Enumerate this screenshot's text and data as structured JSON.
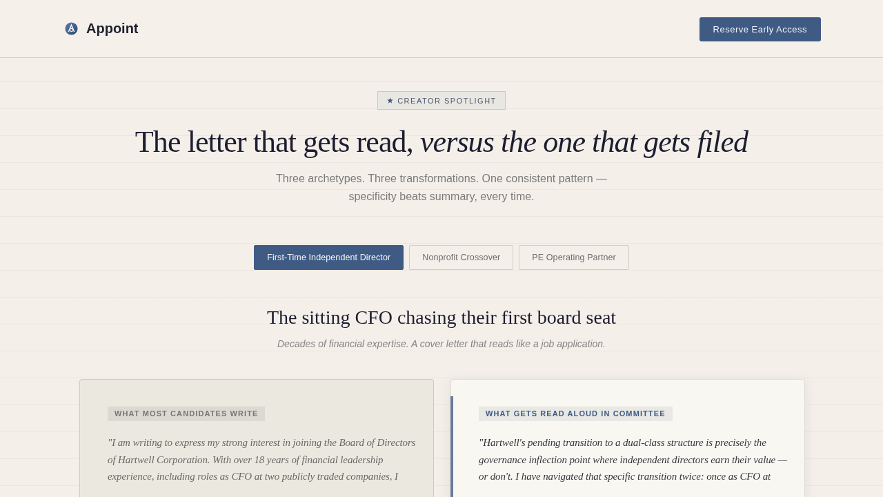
{
  "header": {
    "brand": "Appoint",
    "cta_button": "Reserve Early Access"
  },
  "hero": {
    "badge": "CREATOR SPOTLIGHT",
    "headline": "The letter that gets read, *versus the one that gets filed*",
    "subtitle": "Three archetypes. Three transformations. One consistent pattern — specificity beats summary, every time."
  },
  "tabs": [
    {
      "label": "First-Time Independent Director",
      "selected": true
    },
    {
      "label": "Nonprofit Crossover",
      "selected": false
    },
    {
      "label": "PE Operating Partner",
      "selected": false
    }
  ],
  "section": {
    "title": "The sitting CFO chasing their first board seat",
    "subtitle": "Decades of financial expertise. A cover letter that reads like a job application."
  },
  "comparison_cards": [
    {
      "kind": "typical",
      "label": "WHAT MOST CANDIDATES WRITE",
      "quote": "\"I am writing to express my strong interest in joining the Board of Directors of Hartwell Corporation. With over 18 years of financial leadership experience, including roles as CFO at two publicly traded companies, I"
    },
    {
      "kind": "standout",
      "label": "WHAT GETS READ ALOUD IN COMMITTEE",
      "quote": "\"Hartwell's pending transition to a dual-class structure is precisely the governance inflection point where independent directors earn their value — or don't. I have navigated that specific transition twice: once as CFO at"
    }
  ]
}
